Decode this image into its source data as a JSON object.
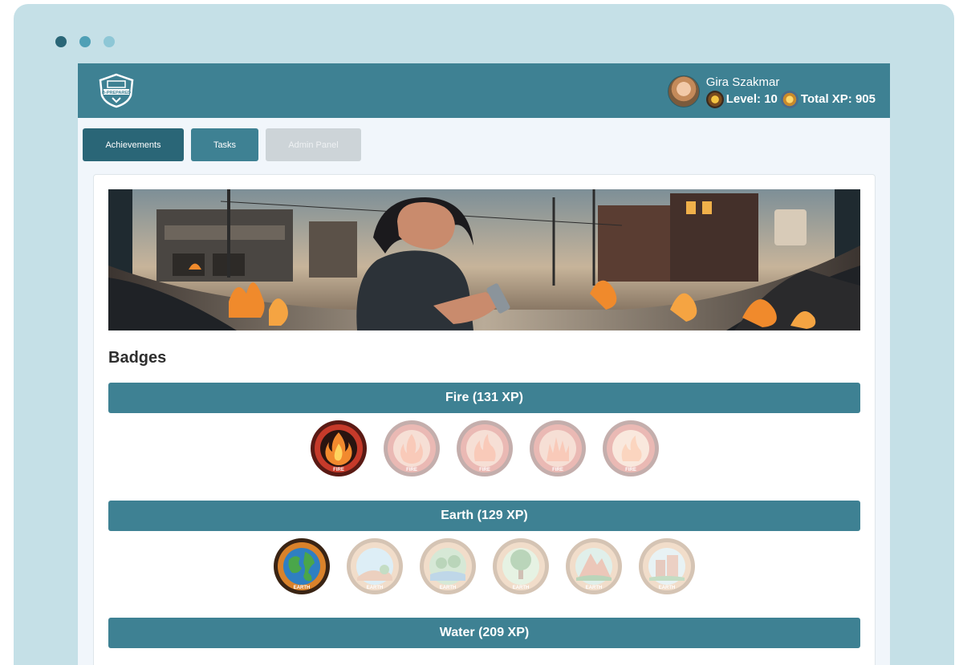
{
  "window": {
    "dots": [
      "#2a6677",
      "#4fa0b6",
      "#8ec7d6"
    ]
  },
  "header": {
    "logo_text": "B-PREPARED",
    "user": {
      "name": "Gira Szakmar",
      "level_text": "Level: 10",
      "xp_text": "Total XP: 905"
    }
  },
  "tabs": [
    {
      "label": "Achievements",
      "active": true
    },
    {
      "label": "Tasks",
      "active": false
    },
    {
      "label": "Admin Panel",
      "disabled": true
    }
  ],
  "main": {
    "badges_title": "Badges"
  },
  "categories": [
    {
      "label": "Fire (131 XP)",
      "theme": "fire",
      "badges": [
        {
          "icon": "fire-badge-icon",
          "earned": true,
          "label": "FIRE"
        },
        {
          "icon": "fire-badge-icon",
          "earned": false,
          "label": "FIRE"
        },
        {
          "icon": "fire-badge-icon",
          "earned": false,
          "label": "FIRE"
        },
        {
          "icon": "fire-badge-icon",
          "earned": false,
          "label": "FIRE"
        },
        {
          "icon": "fire-badge-icon",
          "earned": false,
          "label": "FIRE"
        }
      ]
    },
    {
      "label": "Earth (129 XP)",
      "theme": "earth",
      "badges": [
        {
          "icon": "earth-badge-icon",
          "earned": true,
          "label": "EARTH"
        },
        {
          "icon": "earth-badge-icon",
          "earned": false,
          "label": "EARTH"
        },
        {
          "icon": "earth-badge-icon",
          "earned": false,
          "label": "EARTH"
        },
        {
          "icon": "earth-badge-icon",
          "earned": false,
          "label": "EARTH"
        },
        {
          "icon": "earth-badge-icon",
          "earned": false,
          "label": "EARTH"
        },
        {
          "icon": "earth-badge-icon",
          "earned": false,
          "label": "EARTH"
        }
      ]
    },
    {
      "label": "Water (209 XP)",
      "theme": "water",
      "badges": []
    }
  ],
  "colors": {
    "primary": "#3e8193",
    "primary_dark": "#2a6677",
    "disabled": "#cdd4d8",
    "page_bg": "#f1f6fb",
    "frame_bg": "#c5e0e7"
  }
}
